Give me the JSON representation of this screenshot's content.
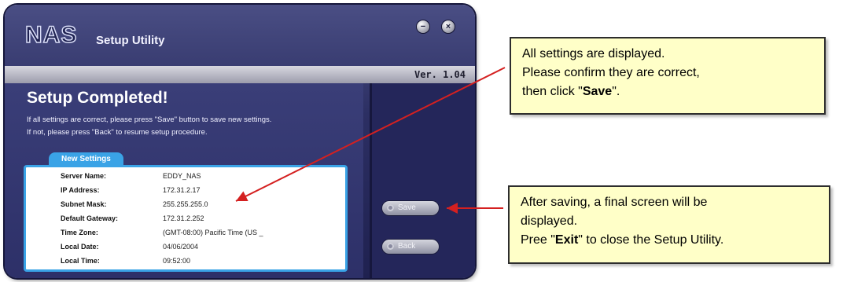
{
  "window": {
    "logo": "NAS",
    "title": "Setup Utility",
    "version": "Ver. 1.04",
    "minimize_glyph": "−",
    "close_glyph": "×"
  },
  "content": {
    "heading": "Setup Completed!",
    "message_line1": "If all settings are correct, please press \"Save\" button to save new settings.",
    "message_line2": "If not, please press \"Back\" to resume setup procedure.",
    "settings_tab_label": "New Settings",
    "settings": [
      {
        "label": "Server Name:",
        "value": "EDDY_NAS"
      },
      {
        "label": "IP Address:",
        "value": "172.31.2.17"
      },
      {
        "label": "Subnet Mask:",
        "value": "255.255.255.0"
      },
      {
        "label": "Default Gateway:",
        "value": "172.31.2.252"
      },
      {
        "label": "Time Zone:",
        "value": "(GMT-08:00) Pacific Time (US _"
      },
      {
        "label": "Local Date:",
        "value": "04/06/2004"
      },
      {
        "label": "Local Time:",
        "value": "09:52:00"
      }
    ]
  },
  "buttons": {
    "save_label": "Save",
    "back_label": "Back"
  },
  "callouts": {
    "first": {
      "line1": "All settings are displayed.",
      "line2": "Please confirm they are correct,",
      "line3_before": "then click \"",
      "line3_bold": "Save",
      "line3_after": "\"."
    },
    "second": {
      "line1": "After saving, a final screen will be",
      "line2": "displayed.",
      "line3_before": "Pree \"",
      "line3_bold": "Exit",
      "line3_after": "\" to close the Setup Utility."
    }
  },
  "colors": {
    "arrow": "#d42020",
    "callout_bg": "#ffffc8",
    "panel_accent": "#3aa3e6",
    "window_bg": "#2c2f63"
  }
}
